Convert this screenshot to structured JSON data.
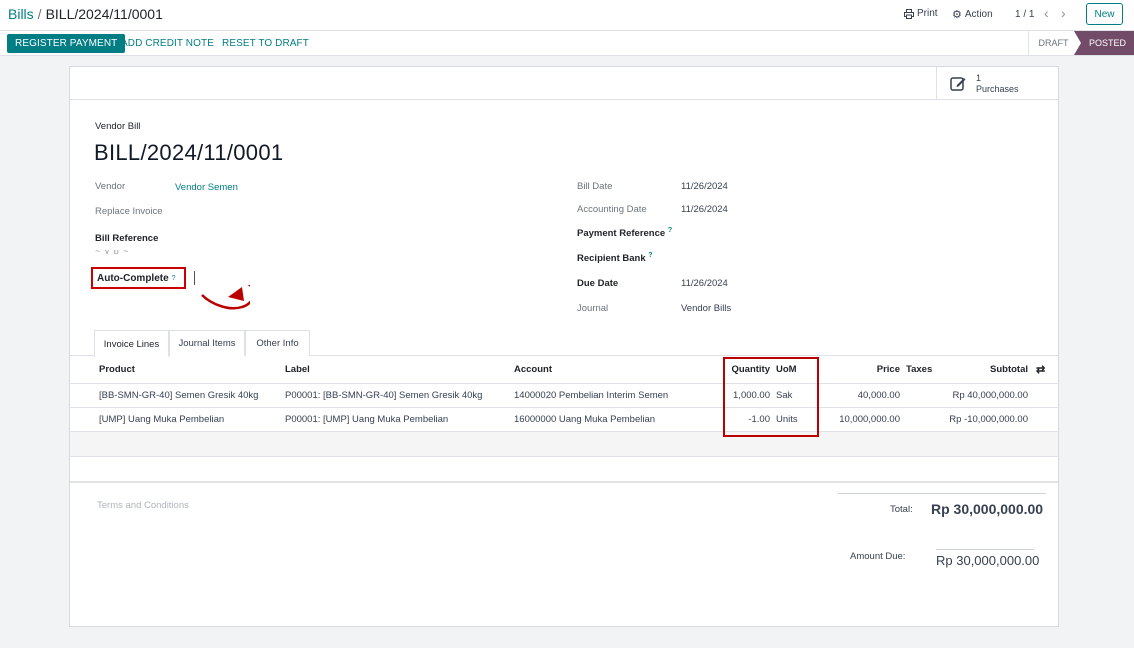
{
  "breadcrumb": {
    "parent": "Bills",
    "separator": "/",
    "current": "BILL/2024/11/0001"
  },
  "control": {
    "print": "Print",
    "action": "Action",
    "pager": "1 / 1",
    "new": "New"
  },
  "statusbar": {
    "register_payment": "REGISTER PAYMENT",
    "add_credit_note": "ADD CREDIT NOTE",
    "reset_to_draft": "RESET TO DRAFT",
    "stages": [
      "DRAFT",
      "POSTED"
    ]
  },
  "smart_button": {
    "count": "1",
    "label": "Purchases"
  },
  "form": {
    "type_label": "Vendor Bill",
    "name": "BILL/2024/11/0001",
    "vendor_label": "Vendor",
    "vendor_value": "Vendor Semen",
    "replace_label": "Replace Invoice",
    "bill_ref_label": "Bill Reference",
    "auto_complete_label": "Auto-Complete",
    "help_mark": "?",
    "bill_date_label": "Bill Date",
    "bill_date_value": "11/26/2024",
    "acc_date_label": "Accounting Date",
    "acc_date_value": "11/26/2024",
    "pay_ref_label": "Payment Reference",
    "recipient_label": "Recipient Bank",
    "due_date_label": "Due Date",
    "due_date_value": "11/26/2024",
    "journal_label": "Journal",
    "journal_value": "Vendor Bills"
  },
  "tabs": [
    "Invoice Lines",
    "Journal Items",
    "Other Info"
  ],
  "table": {
    "headers": [
      "Product",
      "Label",
      "Account",
      "Quantity",
      "UoM",
      "Price",
      "Taxes",
      "Subtotal"
    ],
    "rows": [
      [
        "[BB-SMN-GR-40] Semen Gresik 40kg",
        "P00001: [BB-SMN-GR-40] Semen Gresik 40kg",
        "14000020 Pembelian Interim Semen",
        "1,000.00",
        "Sak",
        "40,000.00",
        "",
        "Rp 40,000,000.00"
      ],
      [
        "[UMP] Uang Muka Pembelian",
        "P00001: [UMP] Uang Muka Pembelian",
        "16000000 Uang Muka Pembelian",
        "-1.00",
        "Units",
        "10,000,000.00",
        "",
        "Rp -10,000,000.00"
      ]
    ]
  },
  "footer": {
    "terms": "Terms and Conditions",
    "total_label": "Total:",
    "total_value": "Rp 30,000,000.00",
    "due_label": "Amount Due:",
    "due_value": "Rp 30,000,000.00"
  },
  "colors": {
    "accent": "#017e84",
    "stage_active": "#714b67",
    "annotation": "#c00000"
  }
}
